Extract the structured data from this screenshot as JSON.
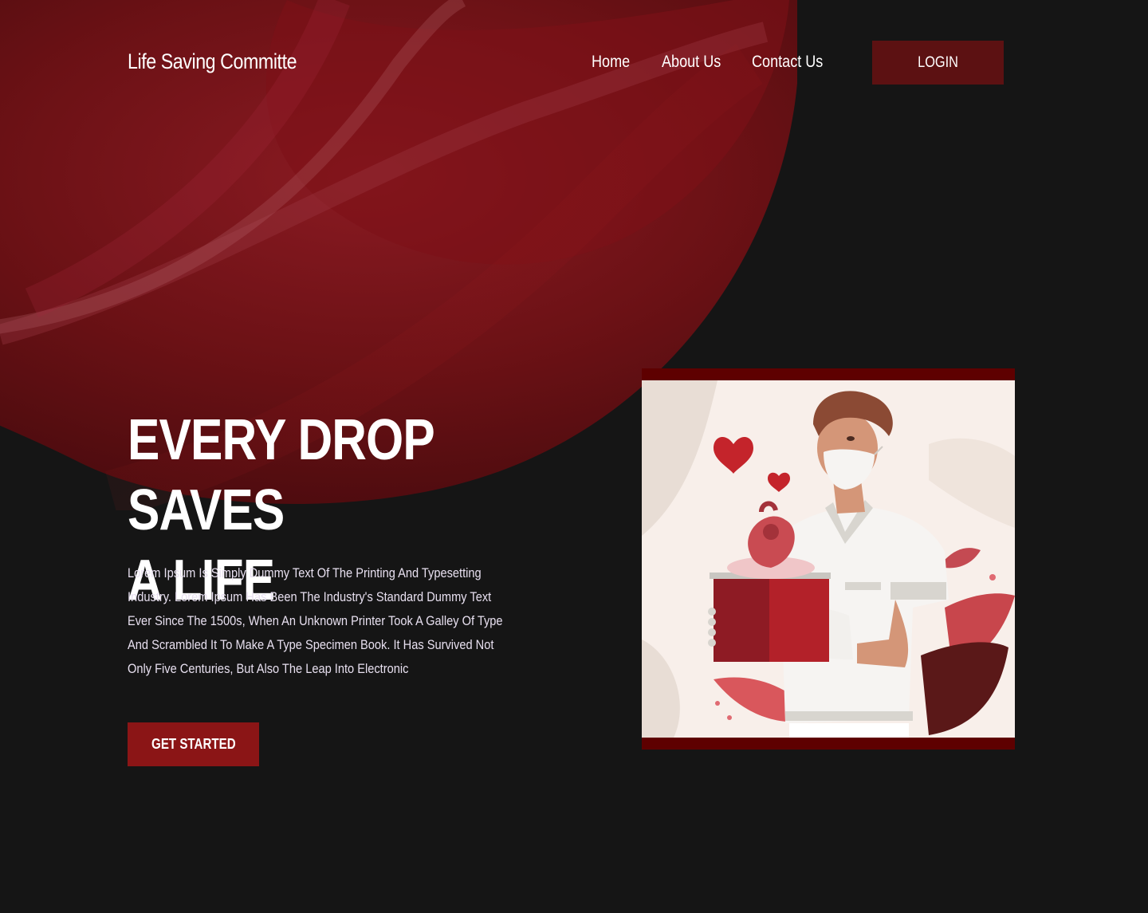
{
  "brand": {
    "name": "Life Saving Committe"
  },
  "nav": {
    "items": [
      {
        "label": "Home"
      },
      {
        "label": "About Us"
      },
      {
        "label": "Contact Us"
      }
    ],
    "login_label": "LOGIN"
  },
  "hero": {
    "title_line1": "EVERY DROP SAVES",
    "title_line2": "A LIFE",
    "description": "Lorem Ipsum Is Simply Dummy Text Of The Printing And Typesetting Industry. Lorem Ipsum Has Been The Industry's Standard Dummy Text Ever Since The 1500s, When An Unknown Printer Took A Galley Of Type And Scrambled It To Make A Type Specimen Book. It Has Survived Not Only Five Centuries, But Also The Leap Into Electronic",
    "cta_label": "GET STARTED"
  },
  "colors": {
    "background": "#151515",
    "accent_dark": "#5c1112",
    "accent": "#8b1516",
    "blob": "#7a1216"
  },
  "illustration": {
    "icon": "doctor-carrying-heart-illustration"
  }
}
